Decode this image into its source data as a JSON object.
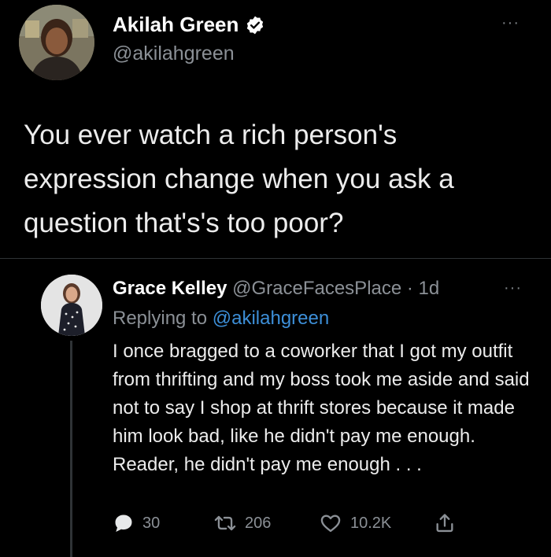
{
  "tweet": {
    "author_name": "Akilah Green",
    "author_handle": "@akilahgreen",
    "more_label": "···",
    "text": "You ever watch a rich person's expression change when you ask a question that's's too poor?"
  },
  "reply": {
    "author_name": "Grace Kelley",
    "author_meta": "@GraceFacesPlace · 1d",
    "more_label": "···",
    "replying_prefix": "Replying to",
    "replying_handle": "@akilahgreen",
    "text": "I once bragged to a coworker that I got my outfit from thrifting and my boss took me aside and said not to say I shop at thrift stores because it made him look bad, like he didn't pay me enough. Reader, he didn't pay me enough . . .",
    "actions": {
      "replies": "30",
      "retweets": "206",
      "likes": "10.2K"
    }
  },
  "colors": {
    "background": "#000000",
    "text": "#e7e9ea",
    "secondary": "#8b9096",
    "link": "#3d8fd8"
  },
  "icons": [
    "verified-badge-icon",
    "more-icon",
    "reply-icon",
    "retweet-icon",
    "like-icon",
    "share-icon"
  ]
}
